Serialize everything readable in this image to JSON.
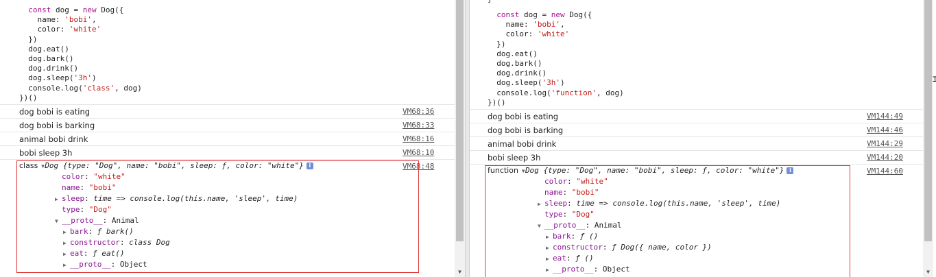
{
  "left": {
    "code_lines": [
      {
        "indent": "  ",
        "parts": [
          [
            "kw",
            "const "
          ],
          [
            "plain",
            "dog = "
          ],
          [
            "kw",
            "new "
          ],
          [
            "plain",
            "Dog({"
          ]
        ]
      },
      {
        "indent": "    ",
        "parts": [
          [
            "plain",
            "name: "
          ],
          [
            "str",
            "'bobi'"
          ],
          [
            "plain",
            ","
          ]
        ]
      },
      {
        "indent": "    ",
        "parts": [
          [
            "plain",
            "color: "
          ],
          [
            "str",
            "'white'"
          ]
        ]
      },
      {
        "indent": "  ",
        "parts": [
          [
            "plain",
            "})"
          ]
        ]
      },
      {
        "indent": "  ",
        "parts": [
          [
            "plain",
            "dog.eat()"
          ]
        ]
      },
      {
        "indent": "  ",
        "parts": [
          [
            "plain",
            "dog.bark()"
          ]
        ]
      },
      {
        "indent": "  ",
        "parts": [
          [
            "plain",
            "dog.drink()"
          ]
        ]
      },
      {
        "indent": "  ",
        "parts": [
          [
            "plain",
            "dog.sleep("
          ],
          [
            "str",
            "'3h'"
          ],
          [
            "plain",
            ")"
          ]
        ]
      },
      {
        "indent": "  ",
        "parts": [
          [
            "plain",
            "console.log("
          ],
          [
            "str",
            "'class'"
          ],
          [
            "plain",
            ", dog)"
          ]
        ]
      },
      {
        "indent": "",
        "parts": [
          [
            "plain",
            "})()"
          ]
        ]
      }
    ],
    "logs": [
      {
        "msg": "dog bobi is eating",
        "src": "VM68:36"
      },
      {
        "msg": "dog bobi is barking",
        "src": "VM68:33"
      },
      {
        "msg": "animal bobi drink",
        "src": "VM68:16"
      },
      {
        "msg": "bobi sleep 3h",
        "src": "VM68:10"
      }
    ],
    "object": {
      "prefix": "class",
      "src": "VM68:48",
      "summary_name": "Dog",
      "summary_body": "{type: \"Dog\", name: \"bobi\", sleep: ƒ, color: \"white\"}",
      "props": [
        {
          "key": "color",
          "val": "\"white\"",
          "kind": "str",
          "expand": false
        },
        {
          "key": "name",
          "val": "\"bobi\"",
          "kind": "str",
          "expand": false
        },
        {
          "key": "sleep",
          "val": "time => console.log(this.name, 'sleep', time)",
          "kind": "fn",
          "expand": true
        },
        {
          "key": "type",
          "val": "\"Dog\"",
          "kind": "str",
          "expand": false
        },
        {
          "key": "__proto__",
          "val": "Animal",
          "kind": "plain",
          "expand": "open"
        }
      ],
      "proto_props": [
        {
          "key": "bark",
          "val": "ƒ bark()",
          "kind": "fn"
        },
        {
          "key": "constructor",
          "val": "class Dog",
          "kind": "fn"
        },
        {
          "key": "eat",
          "val": "ƒ eat()",
          "kind": "fn"
        },
        {
          "key": "__proto__",
          "val": "Object",
          "kind": "plain"
        }
      ]
    }
  },
  "right": {
    "top_fragment": "}",
    "code_lines": [
      {
        "indent": "  ",
        "parts": [
          [
            "kw",
            "const "
          ],
          [
            "plain",
            "dog = "
          ],
          [
            "kw",
            "new "
          ],
          [
            "plain",
            "Dog({"
          ]
        ]
      },
      {
        "indent": "    ",
        "parts": [
          [
            "plain",
            "name: "
          ],
          [
            "str",
            "'bobi'"
          ],
          [
            "plain",
            ","
          ]
        ]
      },
      {
        "indent": "    ",
        "parts": [
          [
            "plain",
            "color: "
          ],
          [
            "str",
            "'white'"
          ]
        ]
      },
      {
        "indent": "  ",
        "parts": [
          [
            "plain",
            "})"
          ]
        ]
      },
      {
        "indent": "  ",
        "parts": [
          [
            "plain",
            "dog.eat()"
          ]
        ]
      },
      {
        "indent": "  ",
        "parts": [
          [
            "plain",
            "dog.bark()"
          ]
        ]
      },
      {
        "indent": "  ",
        "parts": [
          [
            "plain",
            "dog.drink()"
          ]
        ]
      },
      {
        "indent": "  ",
        "parts": [
          [
            "plain",
            "dog.sleep("
          ],
          [
            "str",
            "'3h'"
          ],
          [
            "plain",
            ")"
          ]
        ]
      },
      {
        "indent": "  ",
        "parts": [
          [
            "plain",
            "console.log("
          ],
          [
            "str",
            "'function'"
          ],
          [
            "plain",
            ", dog)"
          ]
        ]
      },
      {
        "indent": "",
        "parts": [
          [
            "plain",
            "})()"
          ]
        ]
      }
    ],
    "logs": [
      {
        "msg": "dog bobi is eating",
        "src": "VM144:49"
      },
      {
        "msg": "dog bobi is barking",
        "src": "VM144:46"
      },
      {
        "msg": "animal bobi drink",
        "src": "VM144:29"
      },
      {
        "msg": "bobi sleep 3h",
        "src": "VM144:20"
      }
    ],
    "object": {
      "prefix": "function",
      "src": "VM144:60",
      "summary_name": "Dog",
      "summary_body": "{type: \"Dog\", name: \"bobi\", sleep: ƒ, color: \"white\"}",
      "props": [
        {
          "key": "color",
          "val": "\"white\"",
          "kind": "str",
          "expand": false
        },
        {
          "key": "name",
          "val": "\"bobi\"",
          "kind": "str",
          "expand": false
        },
        {
          "key": "sleep",
          "val": "time => console.log(this.name, 'sleep', time)",
          "kind": "fn",
          "expand": true
        },
        {
          "key": "type",
          "val": "\"Dog\"",
          "kind": "str",
          "expand": false
        },
        {
          "key": "__proto__",
          "val": "Animal",
          "kind": "plain",
          "expand": "open"
        }
      ],
      "proto_props": [
        {
          "key": "bark",
          "val": "ƒ ()",
          "kind": "fn"
        },
        {
          "key": "constructor",
          "val": "ƒ Dog({ name, color })",
          "kind": "fn"
        },
        {
          "key": "eat",
          "val": "ƒ ()",
          "kind": "fn"
        },
        {
          "key": "__proto__",
          "val": "Object",
          "kind": "plain"
        }
      ]
    }
  },
  "colors": {
    "highlight_border": "#dd3333",
    "keyword": "#aa0d91",
    "string": "#c41a16",
    "key": "#881391"
  },
  "icons": {
    "info": "info-icon",
    "expand": "triangle-right-icon",
    "collapse": "triangle-down-icon",
    "cursor": "mouse-cursor-icon"
  }
}
